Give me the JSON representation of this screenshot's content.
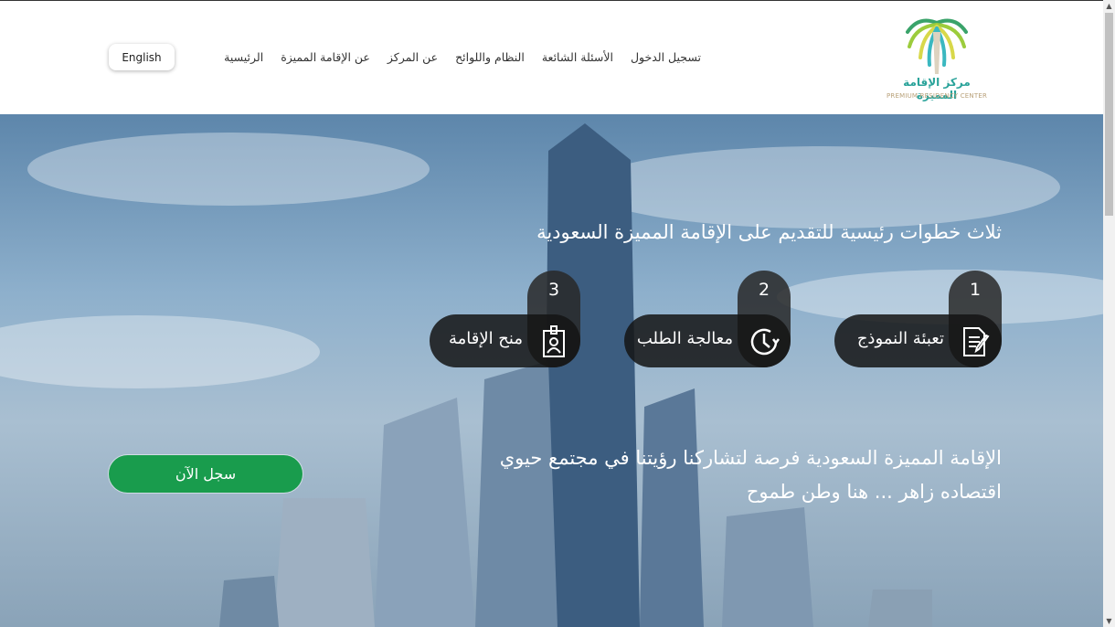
{
  "header": {
    "logo": {
      "ar": "مركز الإقامة المميزة",
      "en": "PREMIUM RESIDENCY CENTER"
    },
    "nav": [
      {
        "label": "الرئيسية"
      },
      {
        "label": "عن الإقامة المميزة"
      },
      {
        "label": "عن المركز"
      },
      {
        "label": "النظام واللوائح"
      },
      {
        "label": "الأسئلة الشائعة"
      },
      {
        "label": "تسجيل الدخول"
      }
    ],
    "language_button": "English"
  },
  "hero": {
    "title": "ثلاث خطوات رئيسية للتقديم على الإقامة المميزة السعودية",
    "steps": [
      {
        "number": "1",
        "label": "تعبئة النموذج",
        "icon": "form-edit-icon"
      },
      {
        "number": "2",
        "label": "معالجة الطلب",
        "icon": "clock-icon"
      },
      {
        "number": "3",
        "label": "منح الإقامة",
        "icon": "id-badge-icon"
      }
    ],
    "tagline_line1": "الإقامة المميزة السعودية فرصة لتشاركنا رؤيتنا في مجتمع حيوي",
    "tagline_line2": "اقتصاده زاهر ... هنا وطن طموح",
    "cta": "سجل الآن"
  },
  "colors": {
    "accent": "#199c4d",
    "logo_teal": "#2aa39a"
  }
}
